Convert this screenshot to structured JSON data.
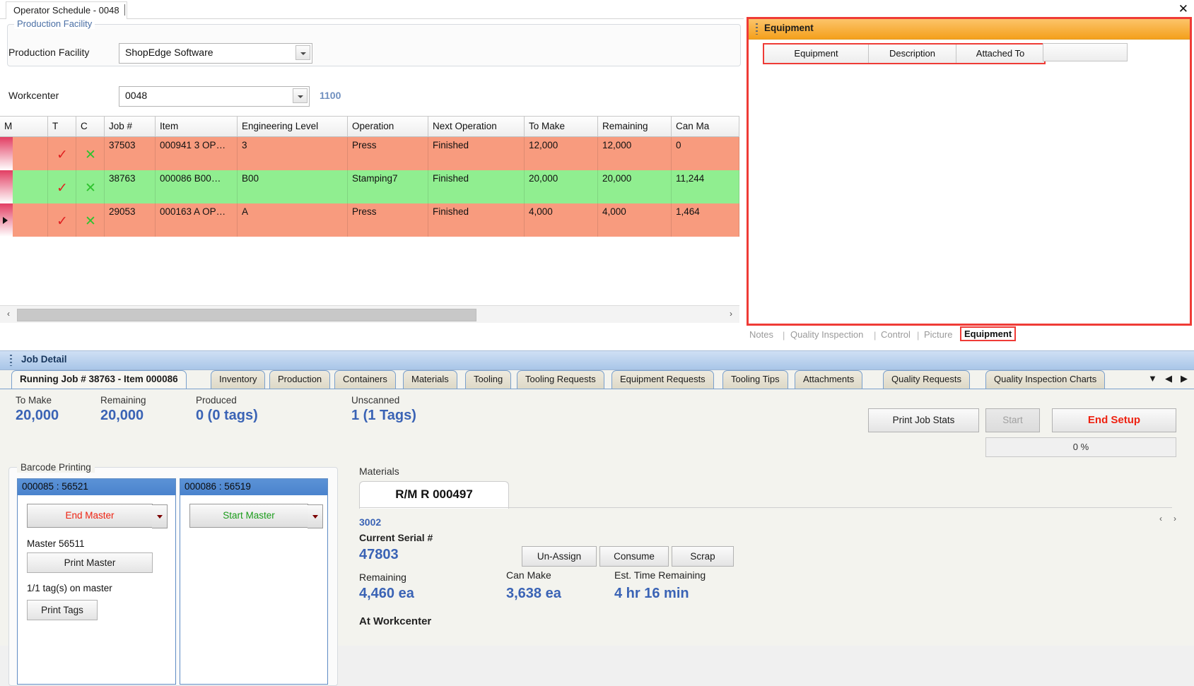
{
  "window": {
    "close_label": "✕",
    "tab_label": "Operator Schedule - 0048"
  },
  "production_facility": {
    "group_title": "Production Facility",
    "label": "Production Facility",
    "value": "ShopEdge Software"
  },
  "workcenter": {
    "label": "Workcenter",
    "value": "0048",
    "code": "1100"
  },
  "schedule_grid": {
    "columns": [
      "M",
      "T",
      "C",
      "Job #",
      "Item",
      "Engineering Level",
      "Operation",
      "Next Operation",
      "To Make",
      "Remaining",
      "Can Ma"
    ],
    "rows": [
      {
        "selected": false,
        "color": "#f89b7e",
        "m": "✕",
        "t": "✓",
        "c": "✕",
        "job": "37503",
        "item": "000941  3  OP…",
        "eng_level": "3",
        "operation": "Press",
        "next_operation": "Finished",
        "to_make": "12,000",
        "remaining": "12,000",
        "can_make": "0"
      },
      {
        "selected": false,
        "color": "#90ee90",
        "m": "✕",
        "t": "✓",
        "c": "✕",
        "job": "38763",
        "item": "000086  B00…",
        "eng_level": "B00",
        "operation": "Stamping7",
        "next_operation": "Finished",
        "to_make": "20,000",
        "remaining": "20,000",
        "can_make": "11,244"
      },
      {
        "selected": true,
        "color": "#f89b7e",
        "m": "✕",
        "t": "✓",
        "c": "✕",
        "job": "29053",
        "item": "000163  A  OP…",
        "eng_level": "A",
        "operation": "Press",
        "next_operation": "Finished",
        "to_make": "4,000",
        "remaining": "4,000",
        "can_make": "1,464"
      }
    ]
  },
  "equipment_window": {
    "title": "Equipment",
    "columns": [
      "Equipment",
      "Description",
      "Attached To"
    ],
    "rows": []
  },
  "equipment_tabs": {
    "items": [
      "Notes",
      "Quality Inspection",
      "Control",
      "Picture",
      "Equipment"
    ],
    "selected": "Equipment",
    "separator": "|"
  },
  "job_detail": {
    "title": "Job Detail",
    "tabs": [
      "Running Job # 38763 - Item 000086",
      "Inventory",
      "Production",
      "Containers",
      "Materials",
      "Tooling",
      "Tooling Requests",
      "Equipment Requests",
      "Tooling Tips",
      "Attachments",
      "Quality Requests",
      "Quality Inspection Charts"
    ],
    "selected_tab": "Running Job # 38763 - Item 000086",
    "nav": {
      "dropdown": "▼",
      "prev": "◀",
      "next": "▶"
    },
    "stats": [
      {
        "label": "To Make",
        "value": "20,000"
      },
      {
        "label": "Remaining",
        "value": "20,000"
      },
      {
        "label": "Produced",
        "value": "0 (0 tags)"
      },
      {
        "label": "Unscanned",
        "value": "1 (1 Tags)"
      }
    ],
    "actions": {
      "print_job_stats": "Print Job Stats",
      "start": "Start",
      "end_setup": "End Setup",
      "progress": "0 %"
    }
  },
  "barcode_printing": {
    "title": "Barcode Printing",
    "cards": [
      {
        "header": "000085 : 56521",
        "action": "End Master",
        "action_color": "#ee2211",
        "master_label": "Master 56511",
        "print_master": "Print Master",
        "tag_info": "1/1 tag(s) on master",
        "print_tags": "Print Tags"
      },
      {
        "header": "000086 : 56519",
        "action": "Start Master",
        "action_color": "#1a9c1a",
        "master_label": "",
        "print_master": "",
        "tag_info": "",
        "print_tags": ""
      }
    ]
  },
  "materials": {
    "title": "Materials",
    "tab_label": "R/M R 000497",
    "part_number": "3002",
    "current_serial_label": "Current Serial #",
    "current_serial": "47803",
    "buttons": [
      "Un-Assign",
      "Consume",
      "Scrap"
    ],
    "remaining_label": "Remaining",
    "remaining_value": "4,460 ea",
    "can_make_label": "Can Make",
    "can_make_value": "3,638 ea",
    "est_time_label": "Est. Time Remaining",
    "est_time_value": "4 hr 16 min",
    "at_workcenter_label": "At Workcenter",
    "nav_prev": "‹",
    "nav_next": "›"
  },
  "grid_scroll": {
    "left": "‹",
    "right": "›"
  }
}
